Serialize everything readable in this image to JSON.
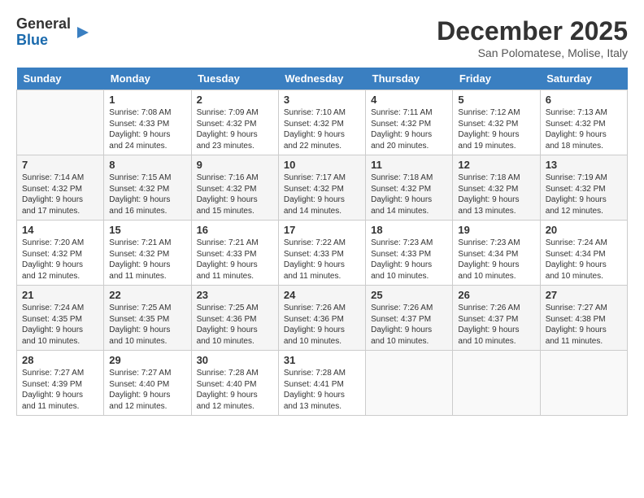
{
  "header": {
    "logo_general": "General",
    "logo_blue": "Blue",
    "title": "December 2025",
    "subtitle": "San Polomatese, Molise, Italy"
  },
  "columns": [
    "Sunday",
    "Monday",
    "Tuesday",
    "Wednesday",
    "Thursday",
    "Friday",
    "Saturday"
  ],
  "weeks": [
    [
      {
        "day": "",
        "empty": true
      },
      {
        "day": "1",
        "sunrise": "7:08 AM",
        "sunset": "4:33 PM",
        "daylight": "9 hours and 24 minutes."
      },
      {
        "day": "2",
        "sunrise": "7:09 AM",
        "sunset": "4:32 PM",
        "daylight": "9 hours and 23 minutes."
      },
      {
        "day": "3",
        "sunrise": "7:10 AM",
        "sunset": "4:32 PM",
        "daylight": "9 hours and 22 minutes."
      },
      {
        "day": "4",
        "sunrise": "7:11 AM",
        "sunset": "4:32 PM",
        "daylight": "9 hours and 20 minutes."
      },
      {
        "day": "5",
        "sunrise": "7:12 AM",
        "sunset": "4:32 PM",
        "daylight": "9 hours and 19 minutes."
      },
      {
        "day": "6",
        "sunrise": "7:13 AM",
        "sunset": "4:32 PM",
        "daylight": "9 hours and 18 minutes."
      }
    ],
    [
      {
        "day": "7",
        "sunrise": "7:14 AM",
        "sunset": "4:32 PM",
        "daylight": "9 hours and 17 minutes."
      },
      {
        "day": "8",
        "sunrise": "7:15 AM",
        "sunset": "4:32 PM",
        "daylight": "9 hours and 16 minutes."
      },
      {
        "day": "9",
        "sunrise": "7:16 AM",
        "sunset": "4:32 PM",
        "daylight": "9 hours and 15 minutes."
      },
      {
        "day": "10",
        "sunrise": "7:17 AM",
        "sunset": "4:32 PM",
        "daylight": "9 hours and 14 minutes."
      },
      {
        "day": "11",
        "sunrise": "7:18 AM",
        "sunset": "4:32 PM",
        "daylight": "9 hours and 14 minutes."
      },
      {
        "day": "12",
        "sunrise": "7:18 AM",
        "sunset": "4:32 PM",
        "daylight": "9 hours and 13 minutes."
      },
      {
        "day": "13",
        "sunrise": "7:19 AM",
        "sunset": "4:32 PM",
        "daylight": "9 hours and 12 minutes."
      }
    ],
    [
      {
        "day": "14",
        "sunrise": "7:20 AM",
        "sunset": "4:32 PM",
        "daylight": "9 hours and 12 minutes."
      },
      {
        "day": "15",
        "sunrise": "7:21 AM",
        "sunset": "4:32 PM",
        "daylight": "9 hours and 11 minutes."
      },
      {
        "day": "16",
        "sunrise": "7:21 AM",
        "sunset": "4:33 PM",
        "daylight": "9 hours and 11 minutes."
      },
      {
        "day": "17",
        "sunrise": "7:22 AM",
        "sunset": "4:33 PM",
        "daylight": "9 hours and 11 minutes."
      },
      {
        "day": "18",
        "sunrise": "7:23 AM",
        "sunset": "4:33 PM",
        "daylight": "9 hours and 10 minutes."
      },
      {
        "day": "19",
        "sunrise": "7:23 AM",
        "sunset": "4:34 PM",
        "daylight": "9 hours and 10 minutes."
      },
      {
        "day": "20",
        "sunrise": "7:24 AM",
        "sunset": "4:34 PM",
        "daylight": "9 hours and 10 minutes."
      }
    ],
    [
      {
        "day": "21",
        "sunrise": "7:24 AM",
        "sunset": "4:35 PM",
        "daylight": "9 hours and 10 minutes."
      },
      {
        "day": "22",
        "sunrise": "7:25 AM",
        "sunset": "4:35 PM",
        "daylight": "9 hours and 10 minutes."
      },
      {
        "day": "23",
        "sunrise": "7:25 AM",
        "sunset": "4:36 PM",
        "daylight": "9 hours and 10 minutes."
      },
      {
        "day": "24",
        "sunrise": "7:26 AM",
        "sunset": "4:36 PM",
        "daylight": "9 hours and 10 minutes."
      },
      {
        "day": "25",
        "sunrise": "7:26 AM",
        "sunset": "4:37 PM",
        "daylight": "9 hours and 10 minutes."
      },
      {
        "day": "26",
        "sunrise": "7:26 AM",
        "sunset": "4:37 PM",
        "daylight": "9 hours and 10 minutes."
      },
      {
        "day": "27",
        "sunrise": "7:27 AM",
        "sunset": "4:38 PM",
        "daylight": "9 hours and 11 minutes."
      }
    ],
    [
      {
        "day": "28",
        "sunrise": "7:27 AM",
        "sunset": "4:39 PM",
        "daylight": "9 hours and 11 minutes."
      },
      {
        "day": "29",
        "sunrise": "7:27 AM",
        "sunset": "4:40 PM",
        "daylight": "9 hours and 12 minutes."
      },
      {
        "day": "30",
        "sunrise": "7:28 AM",
        "sunset": "4:40 PM",
        "daylight": "9 hours and 12 minutes."
      },
      {
        "day": "31",
        "sunrise": "7:28 AM",
        "sunset": "4:41 PM",
        "daylight": "9 hours and 13 minutes."
      },
      {
        "day": "",
        "empty": true
      },
      {
        "day": "",
        "empty": true
      },
      {
        "day": "",
        "empty": true
      }
    ]
  ]
}
